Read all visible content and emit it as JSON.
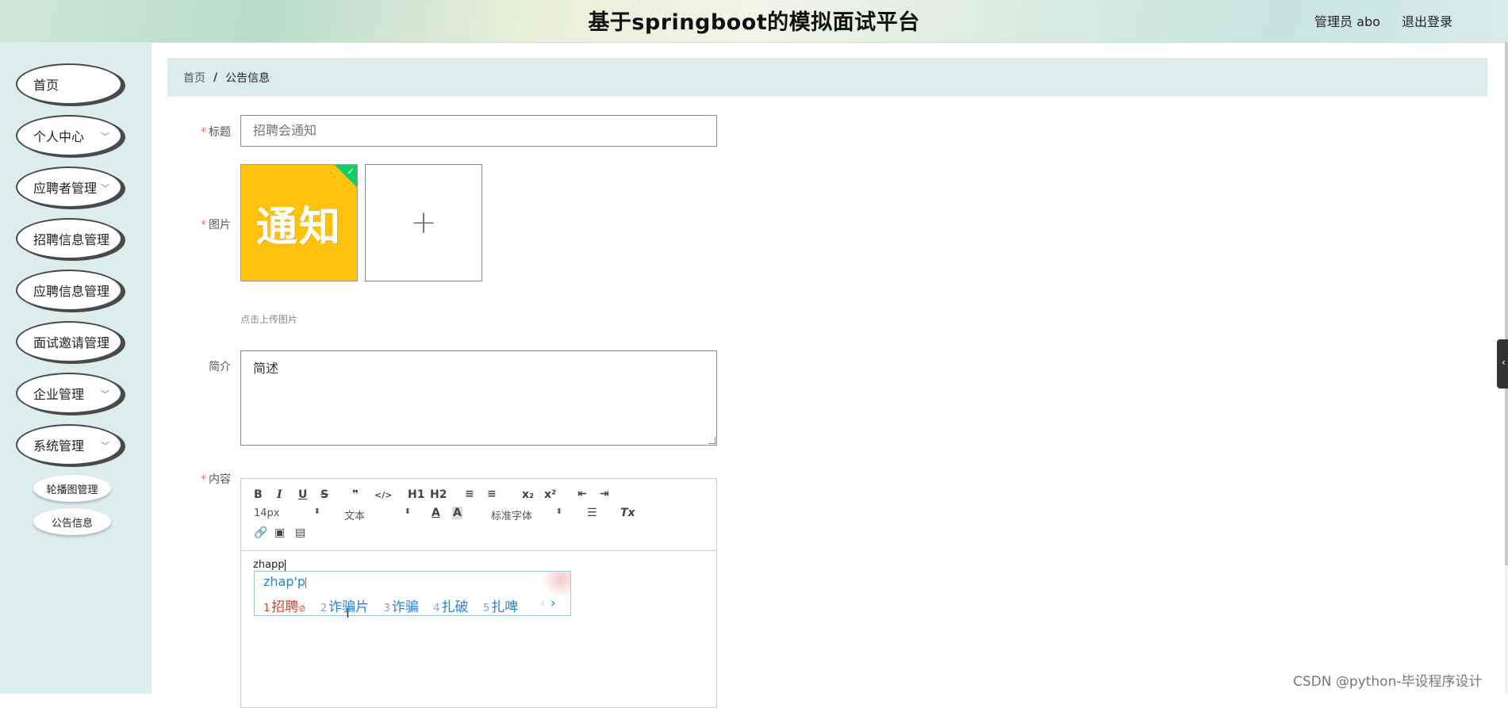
{
  "header": {
    "title": "基于springboot的模拟面试平台",
    "user": "管理员 abo",
    "logout": "退出登录"
  },
  "sidebar": {
    "items": [
      {
        "label": "首页",
        "has_chevron": false
      },
      {
        "label": "个人中心",
        "has_chevron": true
      },
      {
        "label": "应聘者管理",
        "has_chevron": true
      },
      {
        "label": "招聘信息管理",
        "has_chevron": true
      },
      {
        "label": "应聘信息管理",
        "has_chevron": true
      },
      {
        "label": "面试邀请管理",
        "has_chevron": true
      },
      {
        "label": "企业管理",
        "has_chevron": true
      },
      {
        "label": "系统管理",
        "has_chevron": true
      }
    ],
    "sub_items": [
      "轮播图管理",
      "公告信息"
    ]
  },
  "breadcrumb": {
    "home": "首页",
    "separator": "/",
    "current": "公告信息"
  },
  "form": {
    "title_label": "标题",
    "title_value": "招聘会通知",
    "image_label": "图片",
    "image_text": "通知",
    "upload_plus": "+",
    "upload_tip": "点击上传图片",
    "intro_label": "简介",
    "intro_value": "简述",
    "content_label": "内容",
    "required_mark": "*"
  },
  "editor": {
    "toolbar": {
      "bold": "B",
      "italic": "I",
      "underline": "U",
      "strike": "S",
      "quote": "❞",
      "code": "</>",
      "h1": "H1",
      "h2": "H2",
      "ordered_list": "≡",
      "bullet_list": "≡",
      "subscript": "x₂",
      "superscript": "x²",
      "outdent": "⇤",
      "indent": "⇥",
      "font_size": "14px",
      "text_style": "文本",
      "font_family": "标准字体",
      "clear_format": "Tx"
    },
    "content": "zhapp"
  },
  "ime": {
    "input": "zhap'p",
    "candidates": [
      {
        "n": "1",
        "text": "招聘"
      },
      {
        "n": "2",
        "text": "诈骗片"
      },
      {
        "n": "3",
        "text": "诈骗"
      },
      {
        "n": "4",
        "text": "扎破"
      },
      {
        "n": "5",
        "text": "扎啤"
      }
    ],
    "prev": "‹",
    "next": "›"
  },
  "watermark": "CSDN @python-毕设程序设计",
  "colors": {
    "sidebar_bg": "#dcedee",
    "required": "#f56c6c",
    "ime_blue": "#2a7fd8",
    "ime_first": "#e0402a",
    "thumb_bg": "#ffc20e",
    "success": "#13ce66"
  }
}
